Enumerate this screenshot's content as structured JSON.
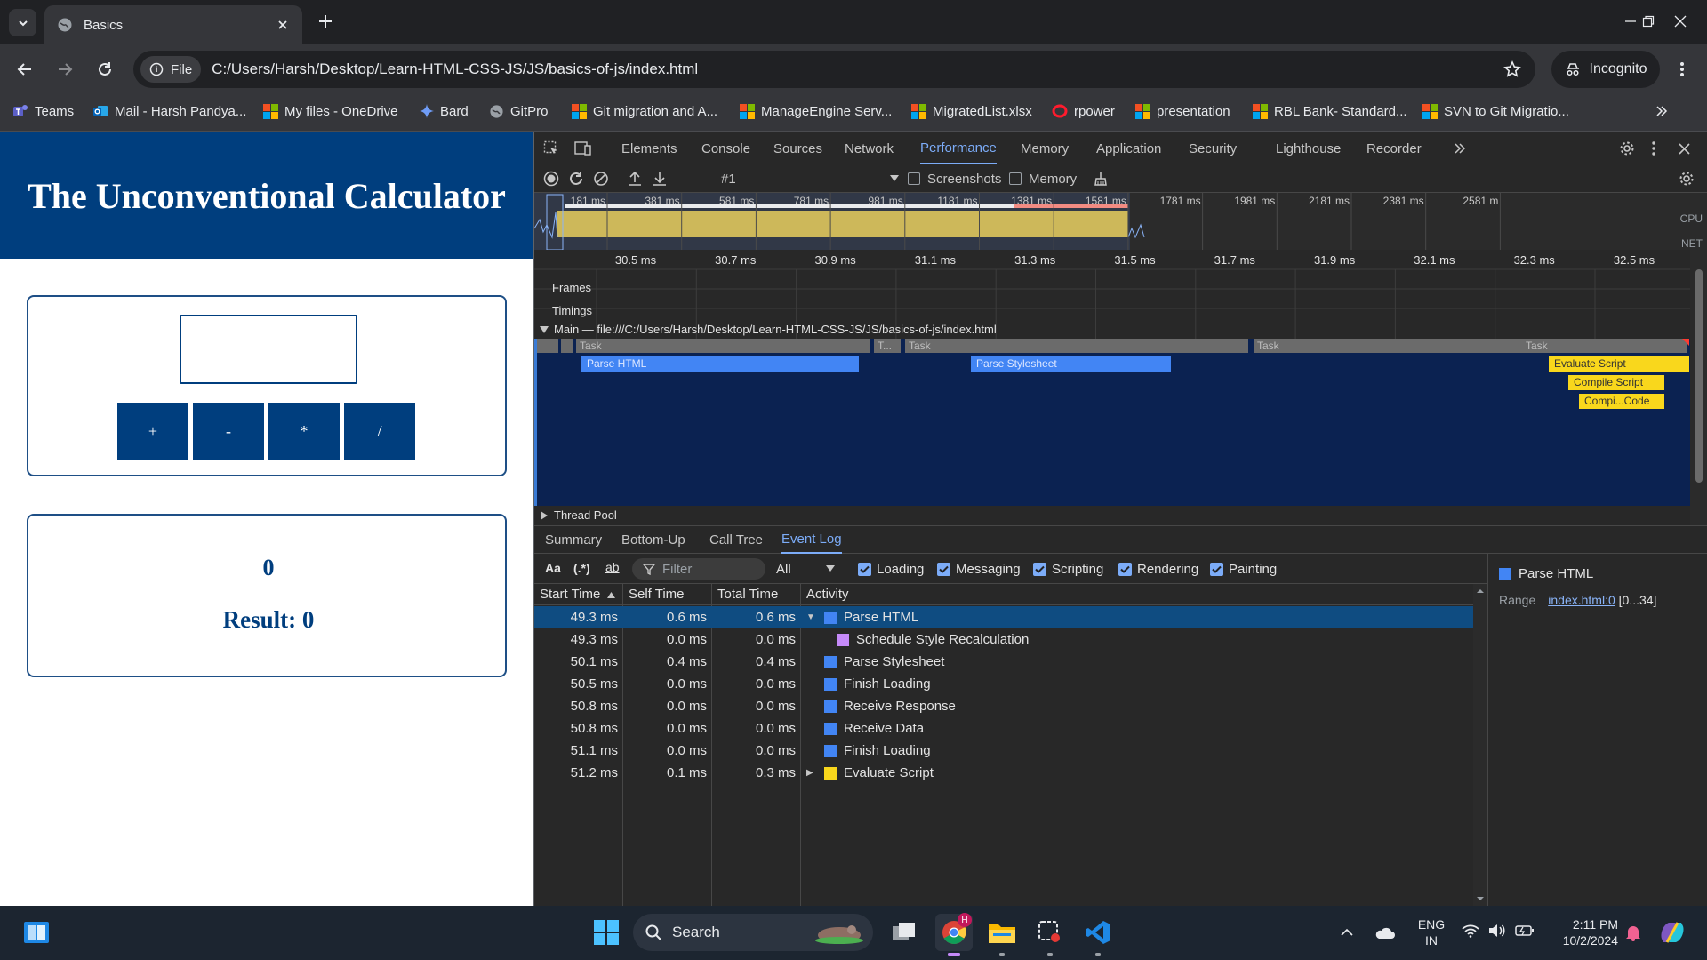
{
  "browser": {
    "tab_title": "Basics",
    "url_chip": "File",
    "url": "C:/Users/Harsh/Desktop/Learn-HTML-CSS-JS/JS/basics-of-js/index.html",
    "profile": "Incognito",
    "bookmarks": [
      {
        "label": "Teams",
        "icon": "teams-icon"
      },
      {
        "label": "Mail - Harsh Pandya...",
        "icon": "outlook-icon"
      },
      {
        "label": "My files - OneDrive",
        "icon": "microsoft-icon"
      },
      {
        "label": "Bard",
        "icon": "bard-sparkle-icon"
      },
      {
        "label": "GitPro",
        "icon": "globe-icon"
      },
      {
        "label": "Git migration and A...",
        "icon": "microsoft-icon"
      },
      {
        "label": "ManageEngine Serv...",
        "icon": "microsoft-icon"
      },
      {
        "label": "MigratedList.xlsx",
        "icon": "microsoft-icon"
      },
      {
        "label": "rpower",
        "icon": "opera-icon"
      },
      {
        "label": "presentation",
        "icon": "microsoft-icon"
      },
      {
        "label": "RBL Bank- Standard...",
        "icon": "microsoft-icon"
      },
      {
        "label": "SVN to Git Migratio...",
        "icon": "microsoft-icon"
      }
    ]
  },
  "page": {
    "title": "The Unconventional Calculator",
    "operators": [
      "+",
      "-",
      "*",
      "/"
    ],
    "current_value": "0",
    "result_text": "Result: 0"
  },
  "devtools": {
    "tabs": [
      "Elements",
      "Console",
      "Sources",
      "Network",
      "Performance",
      "Memory",
      "Application",
      "Security",
      "Lighthouse",
      "Recorder"
    ],
    "active_tab": "Performance",
    "recording_label": "#1",
    "toggles": [
      "Screenshots",
      "Memory"
    ],
    "overview_ticks": [
      "181 ms",
      "381 ms",
      "581 ms",
      "781 ms",
      "981 ms",
      "1181 ms",
      "1381 ms",
      "1581 ms",
      "1781 ms",
      "1981 ms",
      "2181 ms",
      "2381 ms",
      "2581 m"
    ],
    "overview_labels": [
      "CPU",
      "NET"
    ],
    "ruler_ticks": [
      "30.5 ms",
      "30.7 ms",
      "30.9 ms",
      "31.1 ms",
      "31.3 ms",
      "31.5 ms",
      "31.7 ms",
      "31.9 ms",
      "32.1 ms",
      "32.3 ms",
      "32.5 ms"
    ],
    "tracks": {
      "frames": "Frames",
      "timings": "Timings",
      "main": "Main — file:///C:/Users/Harsh/Desktop/Learn-HTML-CSS-JS/JS/basics-of-js/index.html",
      "thread_pool": "Thread Pool"
    },
    "flame": {
      "tasks": [
        "Task",
        "T...",
        "Task",
        "Task",
        "Task"
      ],
      "events": [
        "Parse HTML",
        "Parse Stylesheet",
        "Evaluate Script",
        "Compile Script",
        "Compi...Code"
      ]
    },
    "bottom_tabs": [
      "Summary",
      "Bottom-Up",
      "Call Tree",
      "Event Log"
    ],
    "active_bottom_tab": "Event Log",
    "filter": {
      "case_icon": "Aa",
      "regex_icon": "(.*)",
      "word_icon": "ab",
      "placeholder": "Filter",
      "dropdown": "All",
      "categories": [
        "Loading",
        "Messaging",
        "Scripting",
        "Rendering",
        "Painting"
      ]
    },
    "table": {
      "headers": [
        "Start Time",
        "Self Time",
        "Total Time",
        "Activity"
      ],
      "rows": [
        {
          "start": "49.3 ms",
          "self": "0.6 ms",
          "total": "0.6 ms",
          "activity": "Parse HTML",
          "color": "#4285f4",
          "expander": "▼",
          "indent": 0
        },
        {
          "start": "49.3 ms",
          "self": "0.0 ms",
          "total": "0.0 ms",
          "activity": "Schedule Style Recalculation",
          "color": "#c58af9",
          "expander": "",
          "indent": 1
        },
        {
          "start": "50.1 ms",
          "self": "0.4 ms",
          "total": "0.4 ms",
          "activity": "Parse Stylesheet",
          "color": "#4285f4",
          "expander": "",
          "indent": 0
        },
        {
          "start": "50.5 ms",
          "self": "0.0 ms",
          "total": "0.0 ms",
          "activity": "Finish Loading",
          "color": "#4285f4",
          "expander": "",
          "indent": 0
        },
        {
          "start": "50.8 ms",
          "self": "0.0 ms",
          "total": "0.0 ms",
          "activity": "Receive Response",
          "color": "#4285f4",
          "expander": "",
          "indent": 0
        },
        {
          "start": "50.8 ms",
          "self": "0.0 ms",
          "total": "0.0 ms",
          "activity": "Receive Data",
          "color": "#4285f4",
          "expander": "",
          "indent": 0
        },
        {
          "start": "51.1 ms",
          "self": "0.0 ms",
          "total": "0.0 ms",
          "activity": "Finish Loading",
          "color": "#4285f4",
          "expander": "",
          "indent": 0
        },
        {
          "start": "51.2 ms",
          "self": "0.1 ms",
          "total": "0.3 ms",
          "activity": "Evaluate Script",
          "color": "#f9d71c",
          "expander": "▶",
          "indent": 0
        }
      ]
    },
    "details": {
      "title": "Parse HTML",
      "range_label": "Range",
      "range_link": "index.html:0",
      "range_suffix": "[0...34]"
    }
  },
  "taskbar": {
    "search_placeholder": "Search",
    "lang": "ENG",
    "region": "IN",
    "time": "2:11 PM",
    "date": "10/2/2024",
    "chrome_badge": "H"
  },
  "colors": {
    "page_header": "#003e7e",
    "devtools_accent": "#7cacf8",
    "flame_loading": "#4285f4",
    "flame_scripting": "#f9d71c",
    "main_track_bg": "#0b2251"
  }
}
